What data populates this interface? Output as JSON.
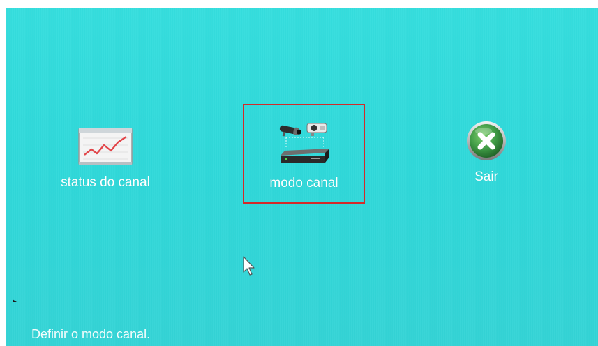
{
  "menu": {
    "items": [
      {
        "label": "status do canal",
        "icon": "line-chart-icon"
      },
      {
        "label": "modo canal",
        "icon": "camera-dvr-icon",
        "selected": true
      },
      {
        "label": "Sair",
        "icon": "close-icon"
      }
    ]
  },
  "status_bar": {
    "text": "Definir o modo canal."
  },
  "colors": {
    "background": "#33dbdb",
    "selection_border": "#d32a2a",
    "text": "#ffffff",
    "exit_green": "#3f9a45"
  }
}
